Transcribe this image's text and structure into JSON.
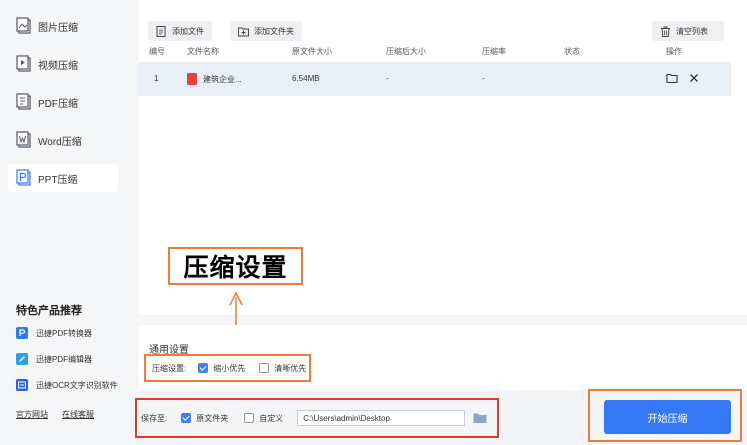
{
  "sidebar": {
    "items": [
      {
        "label": "图片压缩",
        "icon": "image-compress-icon"
      },
      {
        "label": "视频压缩",
        "icon": "video-compress-icon"
      },
      {
        "label": "PDF压缩",
        "icon": "pdf-compress-icon"
      },
      {
        "label": "Word压缩",
        "icon": "word-compress-icon"
      },
      {
        "label": "PPT压缩",
        "icon": "ppt-compress-icon",
        "active": true
      }
    ],
    "recommend_title": "特色产品推荐",
    "recommend": [
      {
        "label": "迅捷PDF转换器",
        "color": "#2b7de9"
      },
      {
        "label": "迅捷PDF编辑器",
        "color": "#2ba0e9"
      },
      {
        "label": "迅捷OCR文字识别软件",
        "color": "#2b5fe9"
      }
    ],
    "links": [
      "官方网站",
      "在线客服"
    ]
  },
  "toolbar": {
    "add_file": "添加文件",
    "add_folder": "添加文件夹",
    "clear_list": "清空列表"
  },
  "table": {
    "headers": [
      "编号",
      "文件名称",
      "原文件大小",
      "压缩后大小",
      "压缩率",
      "状态",
      "操作"
    ],
    "rows": [
      {
        "index": "1",
        "name": "建筑企业...",
        "size": "6.54MB",
        "compressed": "-",
        "ratio": "-",
        "status": ""
      }
    ]
  },
  "annotation": {
    "label": "压缩设置"
  },
  "general": {
    "title": "通用设置",
    "compress_label": "压缩设置:",
    "options": [
      {
        "label": "缩小优先",
        "checked": true
      },
      {
        "label": "清晰优先",
        "checked": false
      }
    ]
  },
  "save": {
    "label": "保存至:",
    "options": [
      {
        "label": "原文件夹",
        "checked": true
      },
      {
        "label": "自定义",
        "checked": false
      }
    ],
    "path": "C:\\Users\\admin\\Desktop"
  },
  "start_button": "开始压缩",
  "colors": {
    "accent": "#3578f6",
    "highlight": "#f07a3e",
    "save_outline": "#e23b2e"
  }
}
